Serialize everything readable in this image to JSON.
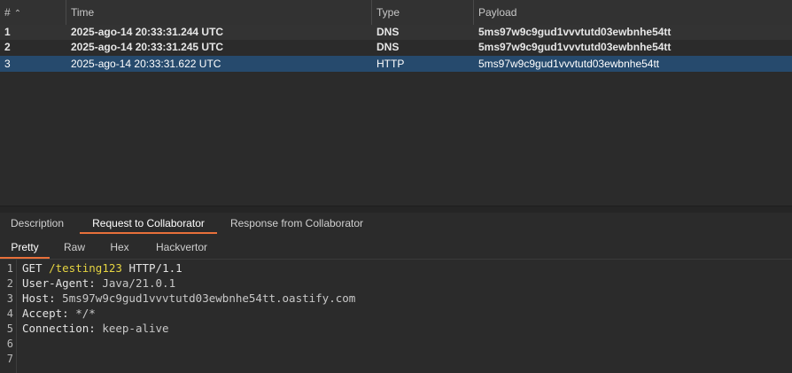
{
  "table": {
    "headers": [
      "#",
      "Time",
      "Type",
      "Payload"
    ],
    "sort_icon": "chevron-up-icon",
    "rows": [
      {
        "num": "1",
        "time": "2025-ago-14 20:33:31.244 UTC",
        "type": "DNS",
        "payload": "5ms97w9c9gud1vvvtutd03ewbnhe54tt"
      },
      {
        "num": "2",
        "time": "2025-ago-14 20:33:31.245 UTC",
        "type": "DNS",
        "payload": "5ms97w9c9gud1vvvtutd03ewbnhe54tt"
      },
      {
        "num": "3",
        "time": "2025-ago-14 20:33:31.622 UTC",
        "type": "HTTP",
        "payload": "5ms97w9c9gud1vvvtutd03ewbnhe54tt"
      }
    ],
    "selected_row": 2
  },
  "detail_tabs": [
    "Description",
    "Request to Collaborator",
    "Response from Collaborator"
  ],
  "detail_tab_active": 1,
  "view_tabs": [
    "Pretty",
    "Raw",
    "Hex",
    "Hackvertor"
  ],
  "view_tab_active": 0,
  "request": {
    "line_numbers": [
      "1",
      "2",
      "3",
      "4",
      "5",
      "6",
      "7"
    ],
    "method": "GET",
    "path": "/testing123",
    "protocol": "HTTP/1.1",
    "headers": [
      {
        "name": "User-Agent:",
        "value": "Java/21.0.1"
      },
      {
        "name": "Host:",
        "value": "5ms97w9c9gud1vvvtutd03ewbnhe54tt.oastify.com"
      },
      {
        "name": "Accept:",
        "value": "*/*"
      },
      {
        "name": "Connection:",
        "value": "keep-alive"
      }
    ]
  },
  "colors": {
    "accent": "#e8703a",
    "selection": "#264a6d",
    "path_highlight": "#e5d441",
    "background": "#2b2b2b"
  }
}
